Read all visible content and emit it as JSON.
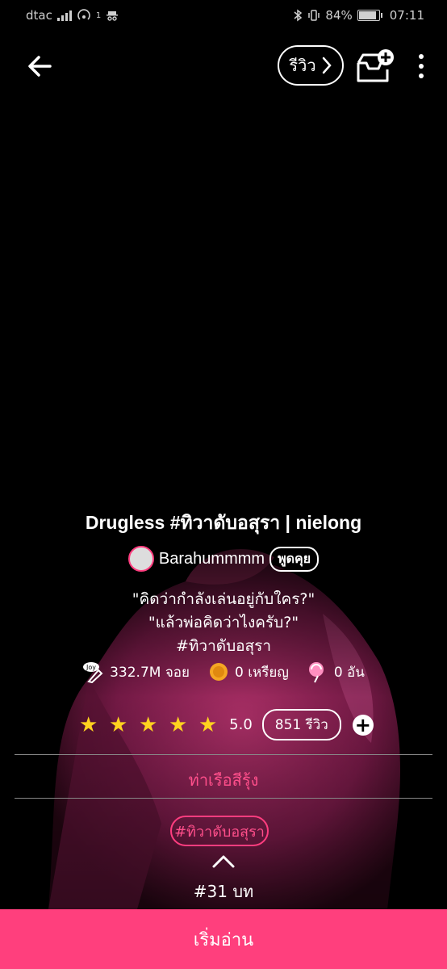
{
  "status_bar": {
    "carrier": "dtac",
    "notification_badge": "1",
    "battery": "84%",
    "time": "07:11"
  },
  "header": {
    "review_label": "รีวิว"
  },
  "story": {
    "title": "Drugless #ทิวาดับอสุรา | nielong",
    "author": "Barahummmm",
    "talk_label": "พูดคุย",
    "description": [
      "\"คิดว่ากำลังเล่นอยู่กับใคร?\"",
      "\"แล้วพ่อคิดว่าไงครับ?\"",
      "#ทิวาดับอสุรา"
    ],
    "stats": {
      "views": "332.7M จอย",
      "coins": "0 เหรียญ",
      "candies": "0 อัน"
    },
    "rating": {
      "stars": 5,
      "value": "5.0",
      "review_count": "851 รีวิว"
    },
    "category": "ท่าเรือสีรุ้ง",
    "tag": "#ทิวาดับอสุรา",
    "episodes": "#31 บท"
  },
  "footer": {
    "start_label": "เริ่มอ่าน"
  },
  "colors": {
    "accent": "#ff3f7d",
    "star": "#ffd21f"
  }
}
